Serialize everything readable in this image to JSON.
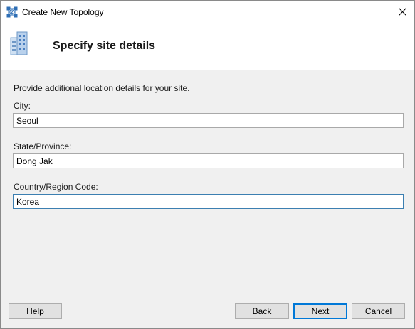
{
  "window": {
    "title": "Create New Topology",
    "close_glyph": "close-icon"
  },
  "header": {
    "title": "Specify site details",
    "icon": "building-icon"
  },
  "content": {
    "intro": "Provide additional location details for your site.",
    "fields": [
      {
        "label": "City:",
        "value": "Seoul"
      },
      {
        "label": "State/Province:",
        "value": "Dong Jak"
      },
      {
        "label": "Country/Region Code:",
        "value": "Korea"
      }
    ]
  },
  "buttons": {
    "help": "Help",
    "back": "Back",
    "next": "Next",
    "cancel": "Cancel"
  },
  "colors": {
    "accent": "#0078d7",
    "window_bg": "#f0f0f0",
    "header_bg": "#ffffff"
  }
}
